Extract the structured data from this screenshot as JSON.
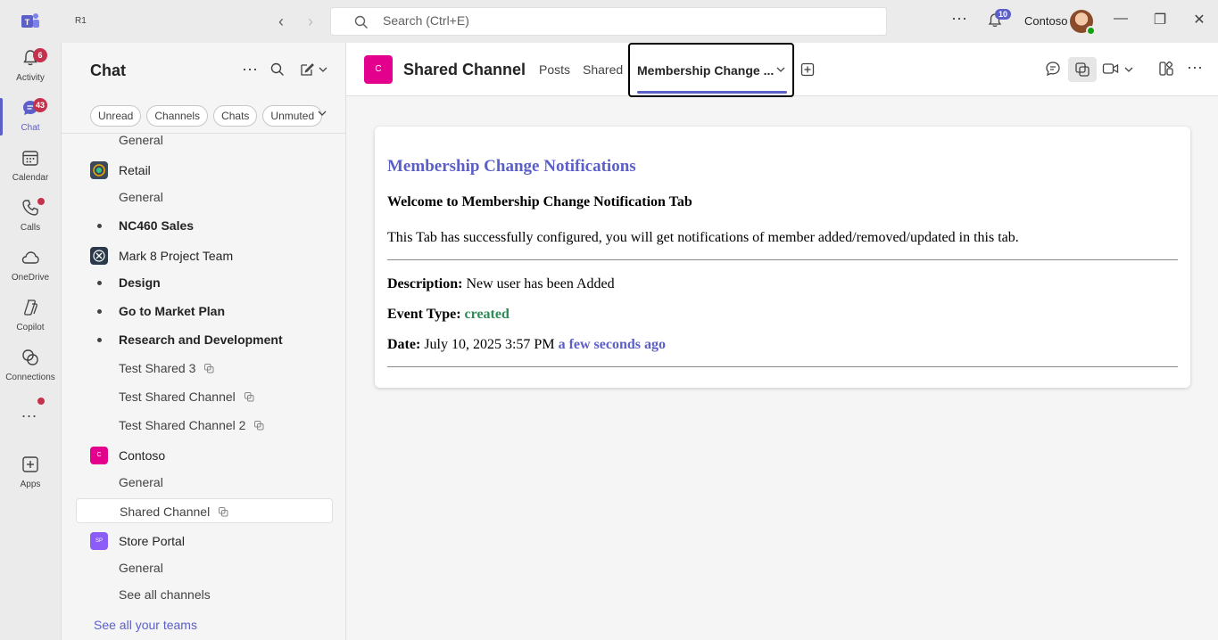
{
  "titlebar": {
    "tag": "R1",
    "search_placeholder": "Search (Ctrl+E)",
    "notifications_count": "10",
    "org_name": "Contoso"
  },
  "rail": {
    "items": [
      {
        "label": "Activity",
        "badge": "6"
      },
      {
        "label": "Chat",
        "badge": "43"
      },
      {
        "label": "Calendar"
      },
      {
        "label": "Calls"
      },
      {
        "label": "OneDrive"
      },
      {
        "label": "Copilot"
      },
      {
        "label": "Connections"
      },
      {
        "label": "Apps"
      }
    ],
    "more_label": "..."
  },
  "chat": {
    "title": "Chat",
    "filters": [
      "Unread",
      "Channels",
      "Chats",
      "Unmuted"
    ],
    "tree": [
      {
        "label": "General",
        "kind": "channel"
      },
      {
        "label": "Retail",
        "kind": "team"
      },
      {
        "label": "General",
        "kind": "channel"
      },
      {
        "label": "NC460 Sales",
        "kind": "bold"
      },
      {
        "label": "Mark 8 Project Team",
        "kind": "team"
      },
      {
        "label": "Design",
        "kind": "bold"
      },
      {
        "label": "Go to Market Plan",
        "kind": "bold"
      },
      {
        "label": "Research and Development",
        "kind": "bold"
      },
      {
        "label": "Test Shared 3",
        "kind": "shared"
      },
      {
        "label": "Test Shared Channel",
        "kind": "shared"
      },
      {
        "label": "Test Shared Channel 2",
        "kind": "shared"
      },
      {
        "label": "Contoso",
        "kind": "team",
        "avatar_text": "C"
      },
      {
        "label": "General",
        "kind": "channel"
      },
      {
        "label": "Shared Channel",
        "kind": "shared-selected"
      },
      {
        "label": "Store Portal",
        "kind": "team",
        "avatar_text": "SP"
      },
      {
        "label": "General",
        "kind": "channel"
      },
      {
        "label": "See all channels",
        "kind": "link"
      }
    ],
    "see_all_teams": "See all your teams"
  },
  "header": {
    "avatar_text": "C",
    "channel_name": "Shared Channel",
    "tabs": [
      "Posts",
      "Shared"
    ],
    "active_tab": "Membership Change ..."
  },
  "card": {
    "title": "Membership Change Notifications",
    "welcome": "Welcome to Membership Change Notification Tab",
    "message": "This Tab has successfully configured, you will get notifications of member added/removed/updated in this tab.",
    "description_label": "Description:",
    "description_value": "New user has been Added",
    "event_type_label": "Event Type:",
    "event_type_value": "created",
    "date_label": "Date:",
    "date_value": "July 10, 2025 3:57 PM",
    "relative_time": "a few seconds ago"
  },
  "colors": {
    "accent": "#5b5fc7",
    "badge_red": "#c4314b",
    "contoso_pink": "#e3008c",
    "store_portal_purple": "#8b5cf6",
    "created_green": "#2e8b57"
  }
}
